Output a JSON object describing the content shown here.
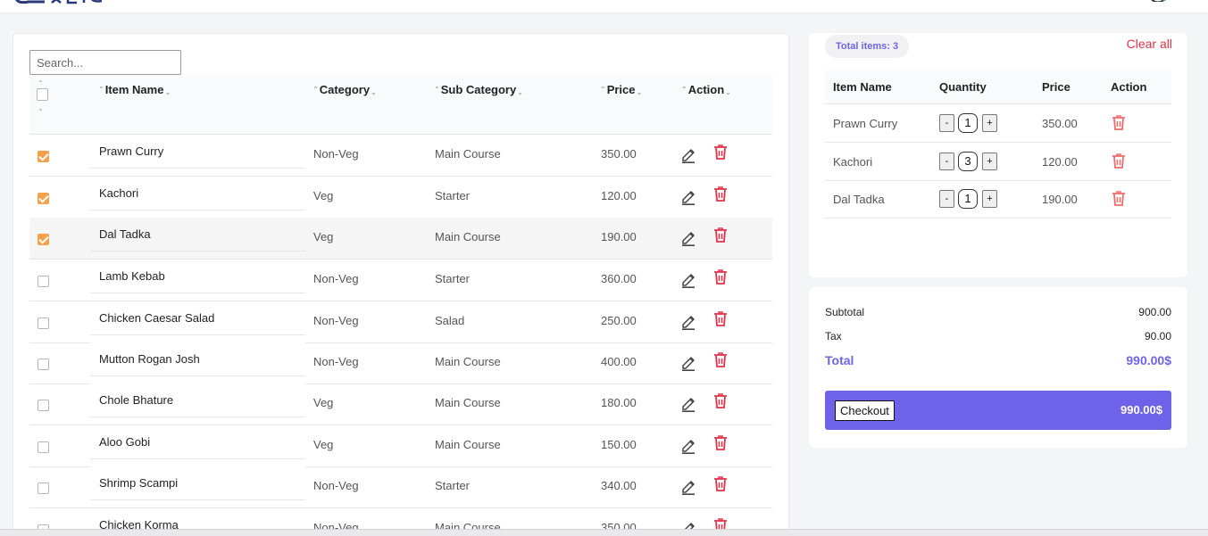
{
  "search": {
    "placeholder": "Search..."
  },
  "table": {
    "columns": [
      "Item Name",
      "Category",
      "Sub Category",
      "Price",
      "Action"
    ],
    "rows": [
      {
        "name": "Prawn Curry",
        "category": "Non-Veg",
        "sub": "Main Course",
        "price": "350.00",
        "checked": true
      },
      {
        "name": "Kachori",
        "category": "Veg",
        "sub": "Starter",
        "price": "120.00",
        "checked": true
      },
      {
        "name": "Dal Tadka",
        "category": "Veg",
        "sub": "Main Course",
        "price": "190.00",
        "checked": true
      },
      {
        "name": "Lamb Kebab",
        "category": "Non-Veg",
        "sub": "Starter",
        "price": "360.00",
        "checked": false
      },
      {
        "name": "Chicken Caesar Salad",
        "category": "Non-Veg",
        "sub": "Salad",
        "price": "250.00",
        "checked": false
      },
      {
        "name": "Mutton Rogan Josh",
        "category": "Non-Veg",
        "sub": "Main Course",
        "price": "400.00",
        "checked": false
      },
      {
        "name": "Chole Bhature",
        "category": "Veg",
        "sub": "Main Course",
        "price": "180.00",
        "checked": false
      },
      {
        "name": "Aloo Gobi",
        "category": "Veg",
        "sub": "Main Course",
        "price": "150.00",
        "checked": false
      },
      {
        "name": "Shrimp Scampi",
        "category": "Non-Veg",
        "sub": "Starter",
        "price": "340.00",
        "checked": false
      },
      {
        "name": "Chicken Korma",
        "category": "Non-Veg",
        "sub": "Main Course",
        "price": "350.00",
        "checked": false
      }
    ]
  },
  "cart": {
    "total_items": "Total items: 3",
    "clear_all": "Clear all",
    "columns": [
      "Item Name",
      "Quantity",
      "Price",
      "Action"
    ],
    "items": [
      {
        "name": "Prawn Curry",
        "qty": "1",
        "price": "350.00"
      },
      {
        "name": "Kachori",
        "qty": "3",
        "price": "120.00"
      },
      {
        "name": "Dal Tadka",
        "qty": "1",
        "price": "190.00"
      }
    ],
    "minus": "-",
    "plus": "+"
  },
  "summary": {
    "subtotal_label": "Subtotal",
    "subtotal": "900.00",
    "tax_label": "Tax",
    "tax": "90.00",
    "total_label": "Total",
    "total": "990.00$",
    "checkout_label": "Checkout",
    "checkout_amount": "990.00$"
  },
  "colors": {
    "accent": "#6d62e8",
    "danger": "#e0334a",
    "check": "#f3a24b"
  },
  "icons": {
    "row_edit": "pencil-icon",
    "row_delete": "trash-icon",
    "sort": "sort-arrows-icon"
  }
}
